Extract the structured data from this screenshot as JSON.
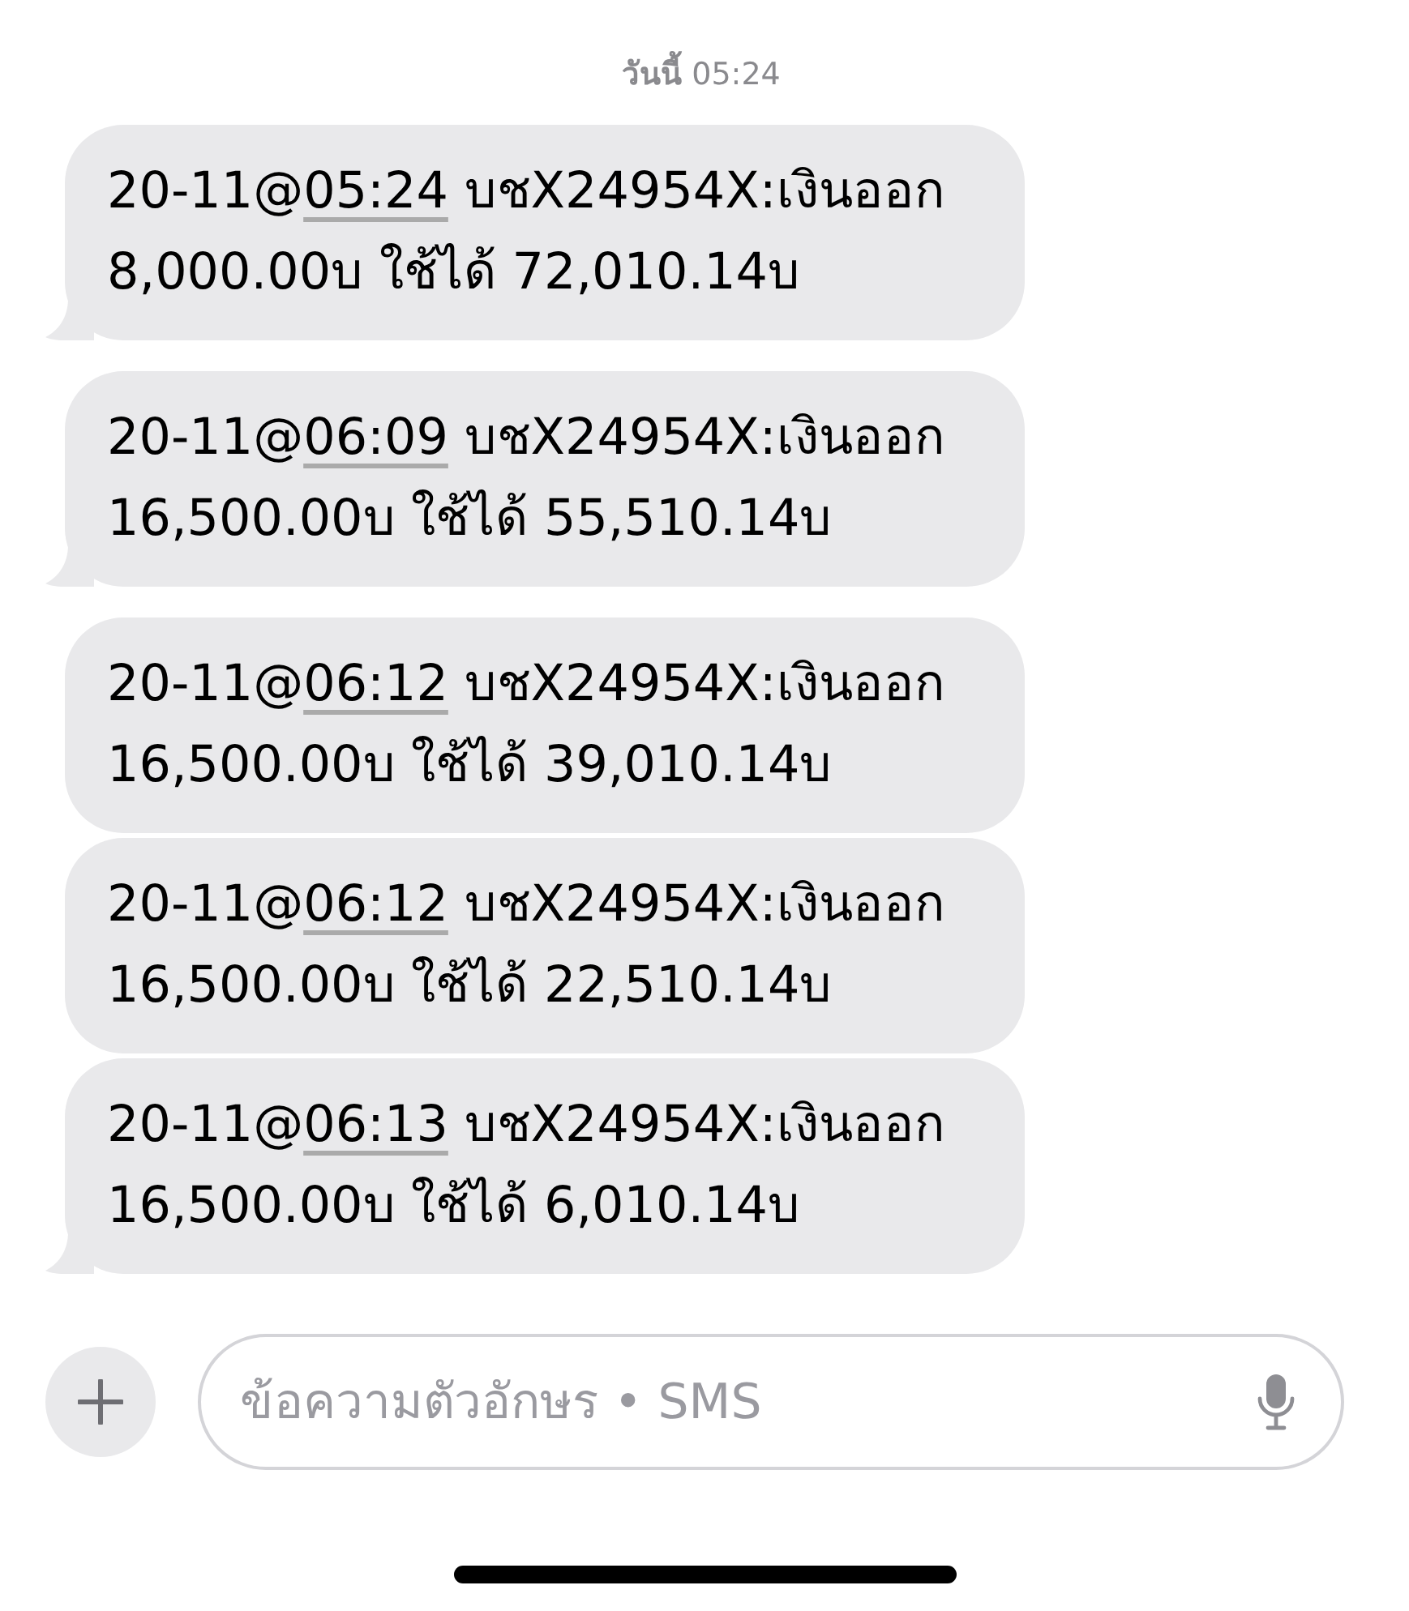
{
  "header": {
    "date": "**วันนี้** 05:24"
  },
  "messages": [
    {
      "prefix": "20-11@",
      "time": "05:24",
      "text": " บชX24954X:เงินออก 8,000.00บ ใช้ได้ 72,010.14บ",
      "tail": true
    },
    {
      "prefix": "20-11@",
      "time": "06:09",
      "text": " บชX24954X:เงินออก 16,500.00บ ใช้ได้ 55,510.14บ",
      "tail": true
    },
    {
      "prefix": "20-11@",
      "time": "06:12",
      "text": " บชX24954X:เงินออก 16,500.00บ ใช้ได้ 39,010.14บ",
      "tail": false
    },
    {
      "prefix": "20-11@",
      "time": "06:12",
      "text": " บชX24954X:เงินออก 16,500.00บ ใช้ได้ 22,510.14บ",
      "tail": false
    },
    {
      "prefix": "20-11@",
      "time": "06:13",
      "text": " บชX24954X:เงินออก 16,500.00บ ใช้ได้ 6,010.14บ",
      "tail": true
    }
  ],
  "composer": {
    "placeholder": "ข้อความตัวอักษร • SMS"
  }
}
